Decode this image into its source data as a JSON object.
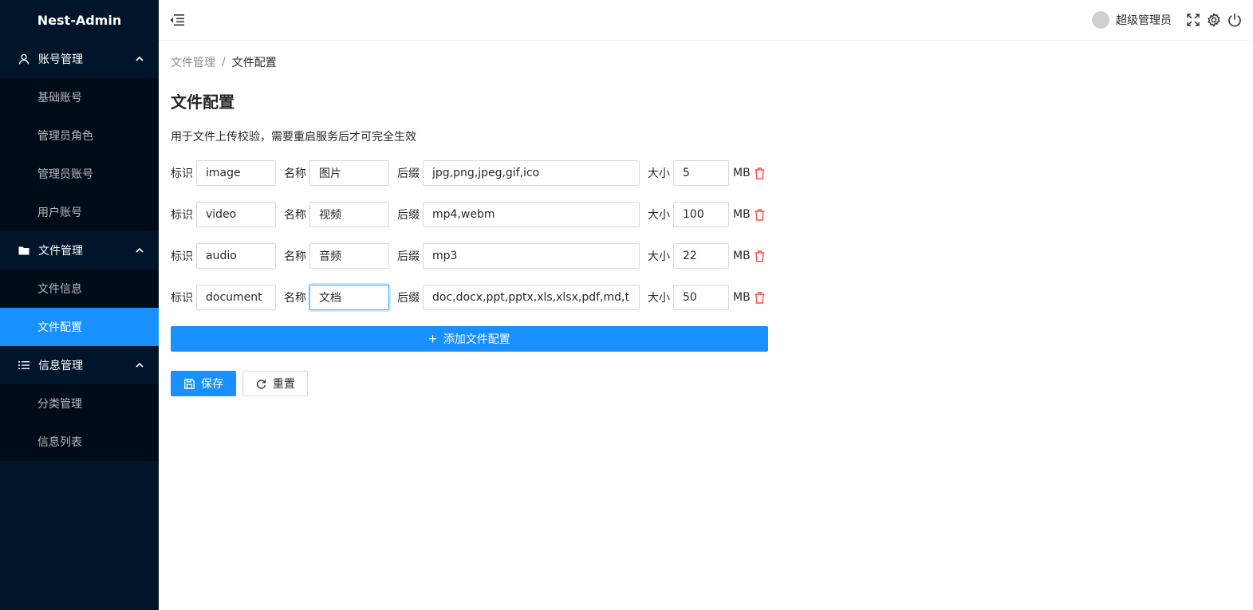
{
  "app": {
    "title": "Nest-Admin"
  },
  "sidebar": {
    "groups": [
      {
        "label": "账号管理",
        "icon": "user-icon",
        "items": [
          "基础账号",
          "管理员角色",
          "管理员账号",
          "用户账号"
        ]
      },
      {
        "label": "文件管理",
        "icon": "folder-icon",
        "items": [
          "文件信息",
          "文件配置"
        ]
      },
      {
        "label": "信息管理",
        "icon": "list-icon",
        "items": [
          "分类管理",
          "信息列表"
        ]
      }
    ],
    "active_item": "文件配置"
  },
  "header": {
    "user_name": "超级管理员",
    "icons": [
      "fullscreen-icon",
      "gear-icon",
      "power-icon"
    ]
  },
  "breadcrumb": {
    "parent": "文件管理",
    "separator": "/",
    "current": "文件配置"
  },
  "page": {
    "title": "文件配置",
    "description": "用于文件上传校验，需要重启服务后才可完全生效"
  },
  "labels": {
    "key": "标识",
    "name": "名称",
    "ext": "后缀",
    "size": "大小",
    "unit": "MB"
  },
  "configs": [
    {
      "key": "image",
      "name": "图片",
      "ext": "jpg,png,jpeg,gif,ico",
      "size": "5"
    },
    {
      "key": "video",
      "name": "视频",
      "ext": "mp4,webm",
      "size": "100"
    },
    {
      "key": "audio",
      "name": "音频",
      "ext": "mp3",
      "size": "22"
    },
    {
      "key": "document",
      "name": "文档",
      "ext": "doc,docx,ppt,pptx,xls,xlsx,pdf,md,txt",
      "size": "50"
    }
  ],
  "buttons": {
    "add": "添加文件配置",
    "save": "保存",
    "reset": "重置"
  },
  "colors": {
    "primary": "#1890ff",
    "sider": "#001529",
    "danger": "#ff4d4f"
  }
}
